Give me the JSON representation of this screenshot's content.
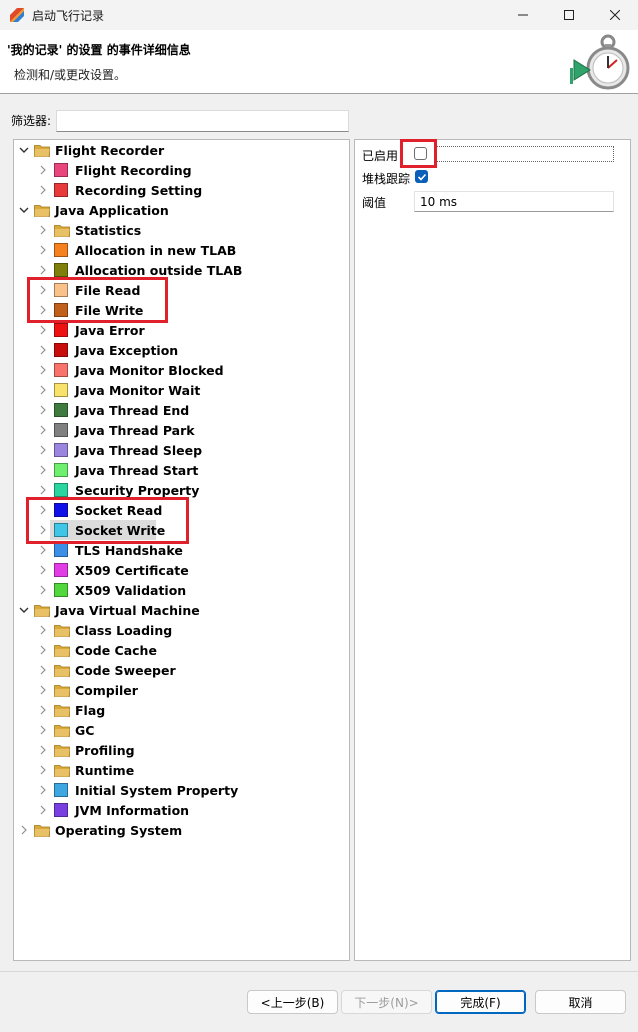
{
  "window": {
    "title": "启动飞行记录",
    "minimize_icon": "minimize-icon",
    "maximize_icon": "maximize-icon",
    "close_icon": "close-icon"
  },
  "header": {
    "title": "'我的记录' 的设置 的事件详细信息",
    "description": "检测和/或更改设置。"
  },
  "filter": {
    "label": "筛选器:",
    "value": ""
  },
  "tree": {
    "nodes": [
      {
        "label": "Flight Recorder",
        "icon": "folder-icon",
        "expanded": true
      },
      {
        "label": "Flight Recording",
        "color": "#e8467c"
      },
      {
        "label": "Recording Setting",
        "color": "#e83a3a"
      },
      {
        "label": "Java Application",
        "icon": "folder-icon",
        "expanded": true
      },
      {
        "label": "Statistics",
        "icon": "folder-icon"
      },
      {
        "label": "Allocation in new TLAB",
        "color": "#f5821f"
      },
      {
        "label": "Allocation outside TLAB",
        "color": "#7f7f0a"
      },
      {
        "label": "File Read",
        "color": "#f9c28a"
      },
      {
        "label": "File Write",
        "color": "#c0601a"
      },
      {
        "label": "Java Error",
        "color": "#ee1111"
      },
      {
        "label": "Java Exception",
        "color": "#c80d0d"
      },
      {
        "label": "Java Monitor Blocked",
        "color": "#f7736b"
      },
      {
        "label": "Java Monitor Wait",
        "color": "#f8e26c"
      },
      {
        "label": "Java Thread End",
        "color": "#3f7a3f"
      },
      {
        "label": "Java Thread Park",
        "color": "#808080"
      },
      {
        "label": "Java Thread Sleep",
        "color": "#9a86de"
      },
      {
        "label": "Java Thread Start",
        "color": "#6ef06e"
      },
      {
        "label": "Security Property",
        "color": "#2ad6a0"
      },
      {
        "label": "Socket Read",
        "color": "#1010e8"
      },
      {
        "label": "Socket Write",
        "color": "#3fc5e5",
        "selected": true
      },
      {
        "label": "TLS Handshake",
        "color": "#3c8fe6"
      },
      {
        "label": "X509 Certificate",
        "color": "#e23ce6"
      },
      {
        "label": "X509 Validation",
        "color": "#52d83c"
      },
      {
        "label": "Java Virtual Machine",
        "icon": "folder-icon",
        "expanded": true
      },
      {
        "label": "Class Loading",
        "icon": "folder-icon"
      },
      {
        "label": "Code Cache",
        "icon": "folder-icon"
      },
      {
        "label": "Code Sweeper",
        "icon": "folder-icon"
      },
      {
        "label": "Compiler",
        "icon": "folder-icon"
      },
      {
        "label": "Flag",
        "icon": "folder-icon"
      },
      {
        "label": "GC",
        "icon": "folder-icon"
      },
      {
        "label": "Profiling",
        "icon": "folder-icon"
      },
      {
        "label": "Runtime",
        "icon": "folder-icon"
      },
      {
        "label": "Initial System Property",
        "color": "#3ca7e0"
      },
      {
        "label": "JVM Information",
        "color": "#7a3fe0"
      },
      {
        "label": "Operating System",
        "icon": "folder-icon",
        "expanded": false
      }
    ]
  },
  "properties": {
    "enabled_label": "已启用",
    "enabled_checked": false,
    "stacktrace_label": "堆栈跟踪",
    "stacktrace_checked": true,
    "threshold_label": "阈值",
    "threshold_value": "10 ms"
  },
  "buttons": {
    "back": "<上一步(B)",
    "next": "下一步(N)>",
    "finish": "完成(F)",
    "cancel": "取消"
  },
  "colors": {
    "highlight": "#e0202a",
    "accent": "#0a5fb8",
    "folder": "#e8c066"
  }
}
